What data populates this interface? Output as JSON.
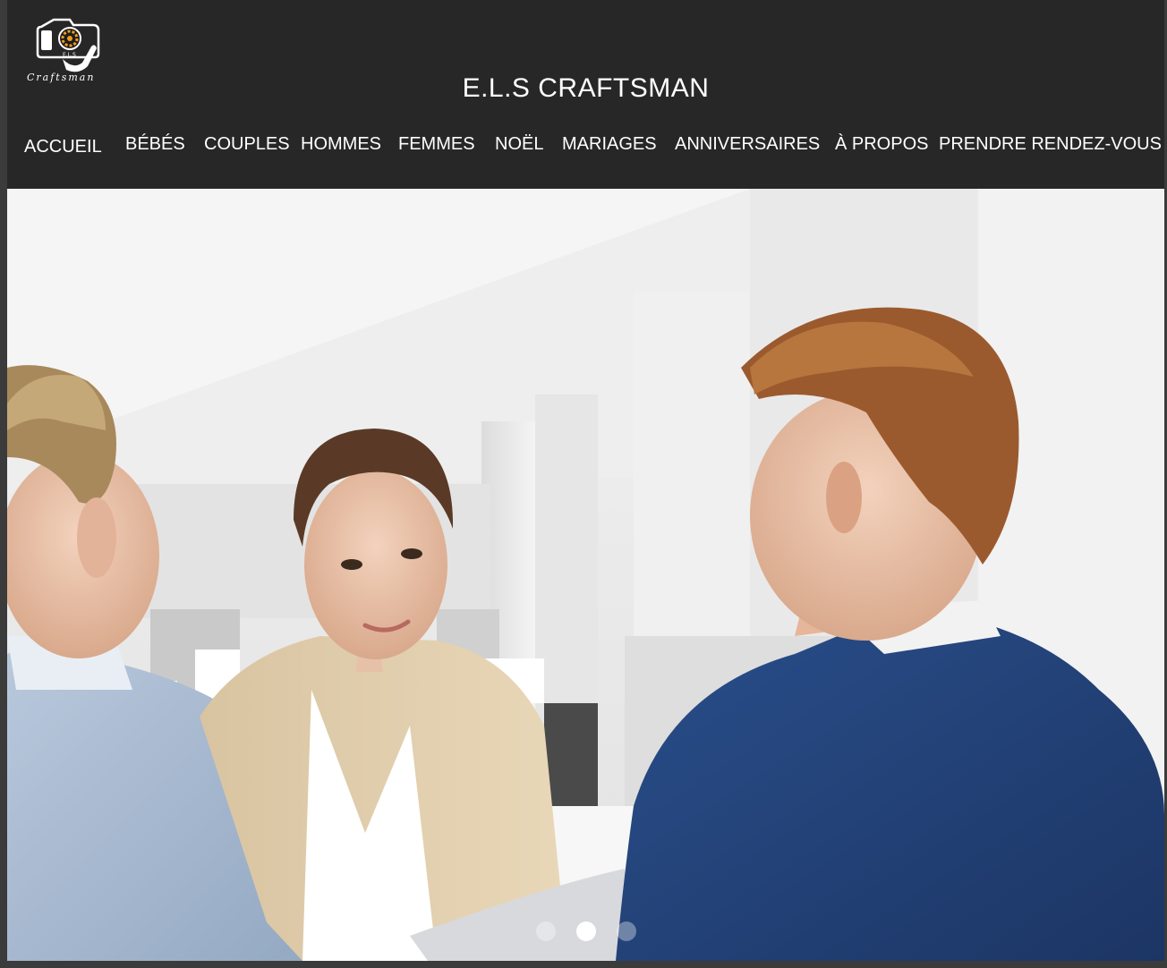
{
  "brand": {
    "title": "E.L.S CRAFTSMAN",
    "logo_icon": "camera-aperture-logo",
    "logo_initials": "E.L.S",
    "logo_script": "Craftsman"
  },
  "nav": {
    "items": [
      {
        "label": "ACCUEIL"
      },
      {
        "label": "BÉBÉS"
      },
      {
        "label": "COUPLES"
      },
      {
        "label": "HOMMES"
      },
      {
        "label": "FEMMES"
      },
      {
        "label": "NOËL"
      },
      {
        "label": "MARIAGES"
      },
      {
        "label": "ANNIVERSAIRES"
      },
      {
        "label": "À PROPOS"
      },
      {
        "label": "PRENDRE RENDEZ-VOUS"
      }
    ]
  },
  "slider": {
    "slide_count": 3,
    "active_index": 1
  },
  "colors": {
    "header_bg": "#272727",
    "frame_bg": "#3b3b3b",
    "logo_accent": "#f29a1a",
    "text": "#ffffff"
  }
}
